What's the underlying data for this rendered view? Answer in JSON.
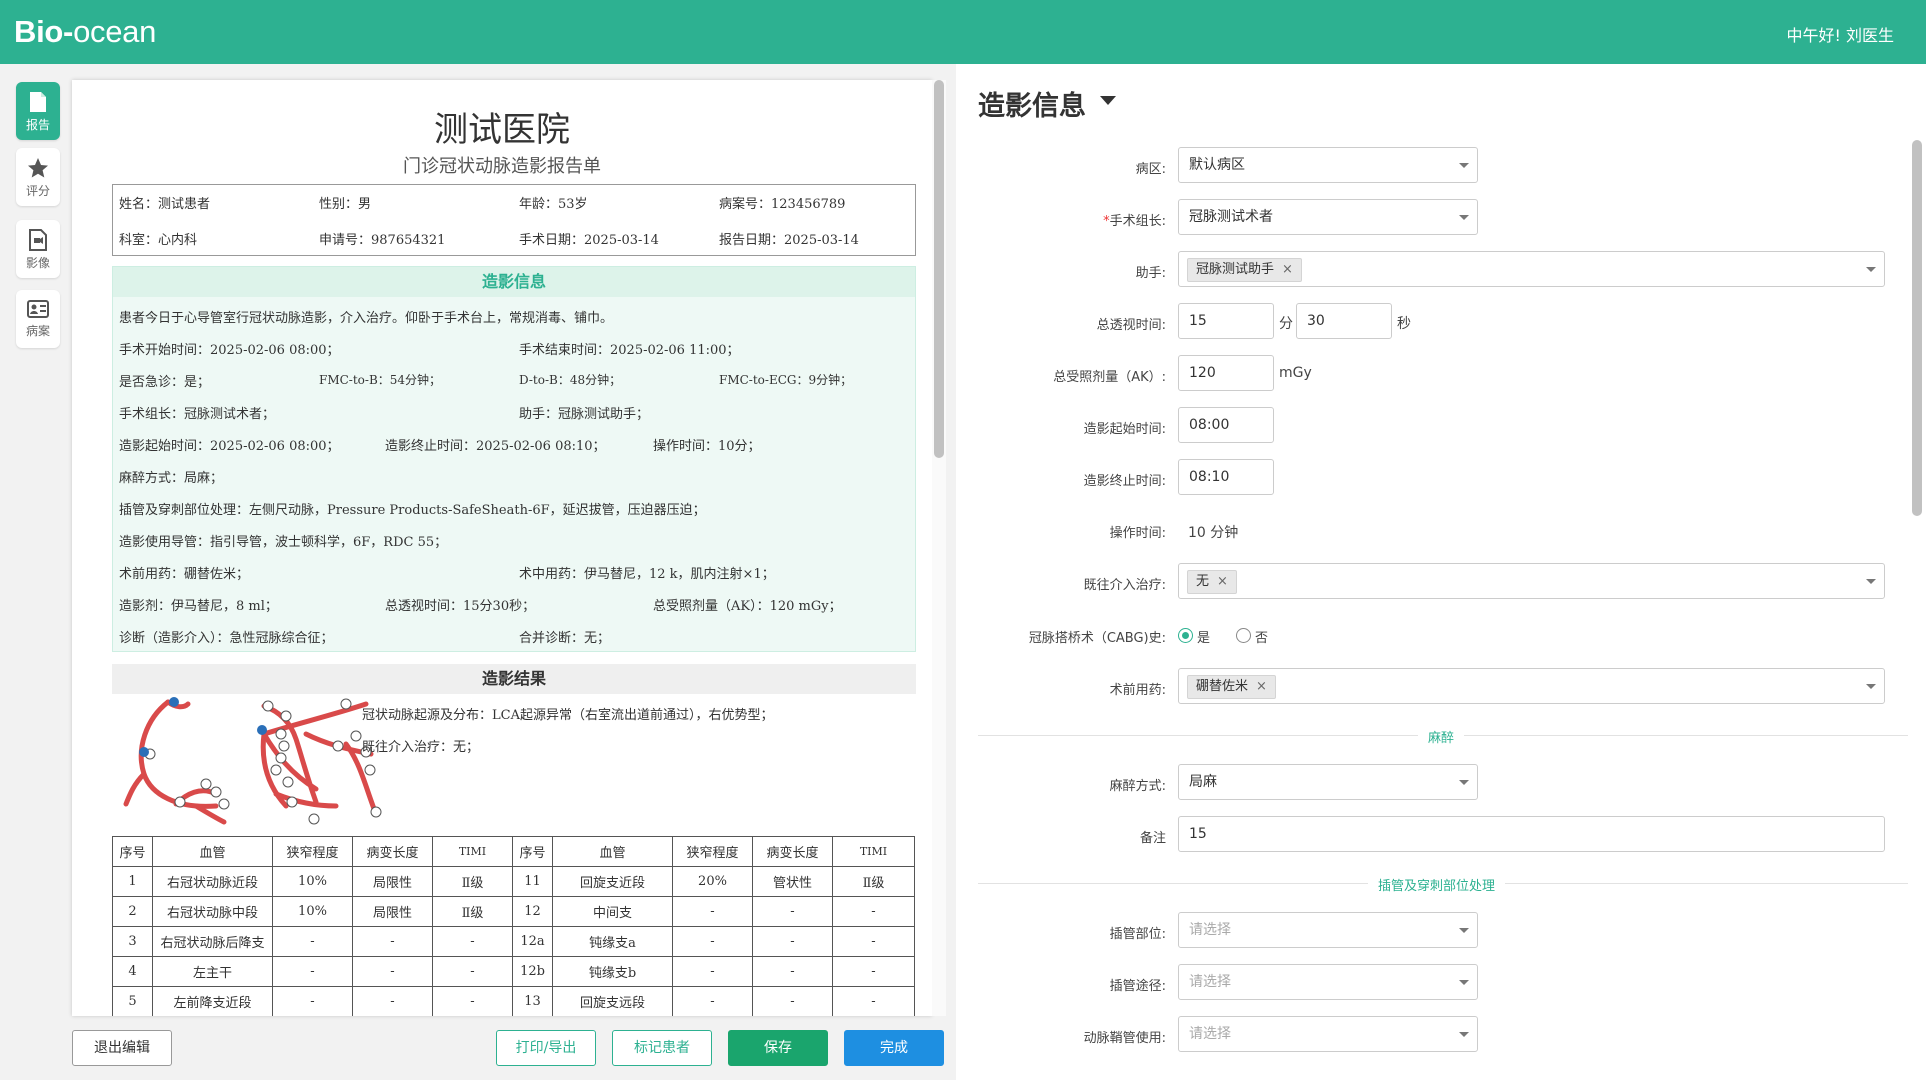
{
  "topbar": {
    "logo_bold": "Bio-",
    "logo_rest": "ocean",
    "greeting": "中午好!  刘医生"
  },
  "sidebar": {
    "items": [
      {
        "label": "报告",
        "icon": "report-icon"
      },
      {
        "label": "评分",
        "icon": "star-icon"
      },
      {
        "label": "影像",
        "icon": "image-icon"
      },
      {
        "label": "病案",
        "icon": "casefile-icon"
      }
    ]
  },
  "report": {
    "hospital": "测试医院",
    "subtitle": "门诊冠状动脉造影报告单",
    "info": {
      "name": "姓名：测试患者",
      "gender": "性别：男",
      "age": "年龄：53岁",
      "case_no": "病案号：123456789",
      "dept": "科室：心内科",
      "apply_no": "申请号：987654321",
      "op_date": "手术日期：2025-03-14",
      "report_date": "报告日期：2025-03-14"
    },
    "angio_title": "造影信息",
    "lines": {
      "l1": "患者今日于心导管室行冠状动脉造影，介入治疗。仰卧于手术台上，常规消毒、铺巾。",
      "start": "手术开始时间：2025-02-06 08:00；",
      "end": "手术结束时间：2025-02-06 11:00；",
      "emergency": "是否急诊：是；",
      "fmc_b": "FMC-to-B：54分钟；",
      "d_b": "D-to-B：48分钟；",
      "fmc_ecg": "FMC-to-ECG：9分钟；",
      "leader": "手术组长：冠脉测试术者；",
      "assistant": "助手：冠脉测试助手；",
      "angio_start": "造影起始时间：2025-02-06 08:00；",
      "angio_end": "造影终止时间：2025-02-06 08:10；",
      "op_time": "操作时间：10分；",
      "anesthesia": "麻醉方式：局麻；",
      "puncture": "插管及穿刺部位处理：左侧尺动脉，Pressure Products-SafeSheath-6F，延迟拔管，压迫器压迫；",
      "catheter": "造影使用导管：指引导管，波士顿科学，6F，RDC 55；",
      "pre_drug": "术前用药：硼替佐米；",
      "intra_drug": "术中用药：伊马替尼，12 k，肌内注射×1；",
      "contrast": "造影剂：伊马替尼，8 ml；",
      "fluoro": "总透视时间：15分30秒；",
      "dose": "总受照剂量（AK）：120 mGy；",
      "diagnosis": "诊断（造影介入）：急性冠脉综合征；",
      "comorbid": "合并诊断：无；"
    },
    "result_title": "造影结果",
    "result_text1": "冠状动脉起源及分布：LCA起源异常（右室流出道前通过），右优势型；",
    "result_text2": "既往介入治疗：无；",
    "table": {
      "headers": [
        "序号",
        "血管",
        "狭窄程度",
        "病变长度",
        "TIMI",
        "序号",
        "血管",
        "狭窄程度",
        "病变长度",
        "TIMI"
      ],
      "rows": [
        [
          "1",
          "右冠状动脉近段",
          "10%",
          "局限性",
          "Ⅱ级",
          "11",
          "回旋支近段",
          "20%",
          "管状性",
          "Ⅱ级"
        ],
        [
          "2",
          "右冠状动脉中段",
          "10%",
          "局限性",
          "Ⅱ级",
          "12",
          "中间支",
          "-",
          "-",
          "-"
        ],
        [
          "3",
          "右冠状动脉后降支",
          "-",
          "-",
          "-",
          "12a",
          "钝缘支a",
          "-",
          "-",
          "-"
        ],
        [
          "4",
          "左主干",
          "-",
          "-",
          "-",
          "12b",
          "钝缘支b",
          "-",
          "-",
          "-"
        ],
        [
          "5",
          "左前降支近段",
          "-",
          "-",
          "-",
          "13",
          "回旋支远段",
          "-",
          "-",
          "-"
        ]
      ]
    }
  },
  "buttons": {
    "exit": "退出编辑",
    "print": "打印/导出",
    "mark": "标记患者",
    "save": "保存",
    "done": "完成"
  },
  "form": {
    "title": "造影信息",
    "ward_label": "病区:",
    "ward_value": "默认病区",
    "leader_req": "*",
    "leader_label": "手术组长:",
    "leader_value": "冠脉测试术者",
    "assistant_label": "助手:",
    "assistant_tag": "冠脉测试助手",
    "fluoro_label": "总透视时间:",
    "fluoro_min": "15",
    "fluoro_min_unit": "分",
    "fluoro_sec": "30",
    "fluoro_sec_unit": "秒",
    "dose_label": "总受照剂量（AK）:",
    "dose_value": "120",
    "dose_unit": "mGy",
    "astart_label": "造影起始时间:",
    "astart_value": "08:00",
    "aend_label": "造影终止时间:",
    "aend_value": "08:10",
    "optime_label": "操作时间:",
    "optime_value": "10 分钟",
    "prior_label": "既往介入治疗:",
    "prior_tag": "无",
    "cabg_label": "冠脉搭桥术（CABG)史:",
    "cabg_yes": "是",
    "cabg_no": "否",
    "predrug_label": "术前用药:",
    "predrug_tag": "硼替佐米",
    "anesthesia_section": "麻醉",
    "anesth_label": "麻醉方式:",
    "anesth_value": "局麻",
    "note_label": "备注",
    "note_value": "15",
    "puncture_section": "插管及穿刺部位处理",
    "site_label": "插管部位:",
    "site_ph": "请选择",
    "route_label": "插管途径:",
    "route_ph": "请选择",
    "sheath_label": "动脉鞘管使用:",
    "sheath_ph": "请选择"
  },
  "colors": {
    "brand": "#2db191",
    "blue": "#1e8fe1",
    "save": "#1aa56d"
  }
}
